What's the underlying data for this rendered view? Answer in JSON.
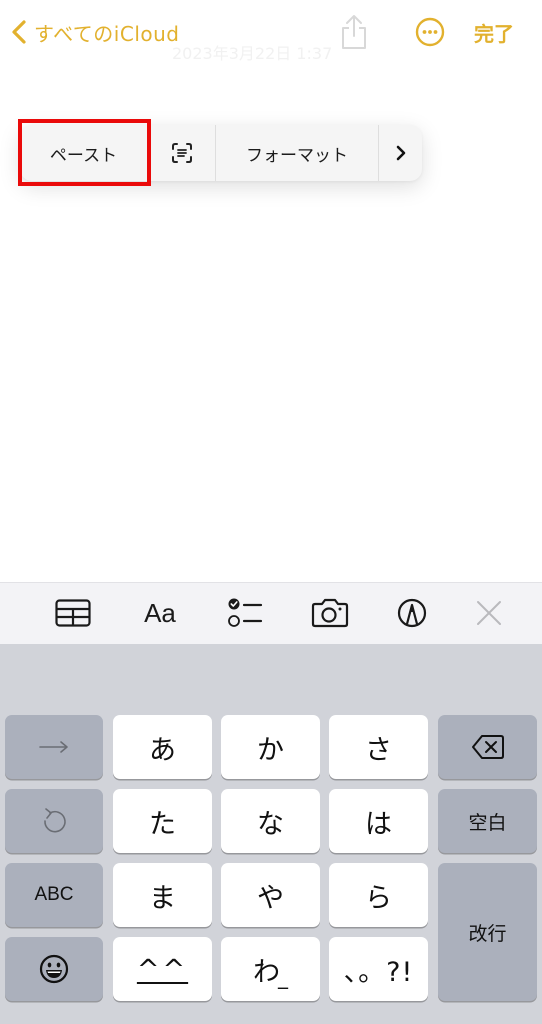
{
  "navbar": {
    "back_label": "すべてのiCloud",
    "date": "2023年3月22日 1:37",
    "done_label": "完了",
    "accent_color": "#e2b12e"
  },
  "context_menu": {
    "paste_label": "ペースト",
    "scan_text_icon": "scan-text-icon",
    "format_label": "フォーマット",
    "next_icon": "chevron-right-icon",
    "highlighted_item": "ペースト"
  },
  "toolbar": {
    "table_icon": "table-icon",
    "format_text_label": "Aa",
    "checklist_icon": "checklist-icon",
    "camera_icon": "camera-icon",
    "markup_icon": "markup-pen-icon",
    "close_icon": "close-icon"
  },
  "keyboard": {
    "rows": [
      [
        "→",
        "あ",
        "か",
        "さ",
        "delete"
      ],
      [
        "undo",
        "た",
        "な",
        "は",
        "空白"
      ],
      [
        "ABC",
        "ま",
        "や",
        "ら",
        "改行"
      ],
      [
        "emoji",
        "^^",
        "わ",
        "、。?!"
      ]
    ],
    "keys": {
      "next": "→",
      "a": "あ",
      "ka": "か",
      "sa": "さ",
      "ta": "た",
      "na": "な",
      "ha": "は",
      "space": "空白",
      "abc": "ABC",
      "ma": "ま",
      "ya": "や",
      "ra": "ら",
      "return": "改行",
      "kaomoji": "^^",
      "wa": "わ",
      "punct": "、。?!"
    }
  }
}
